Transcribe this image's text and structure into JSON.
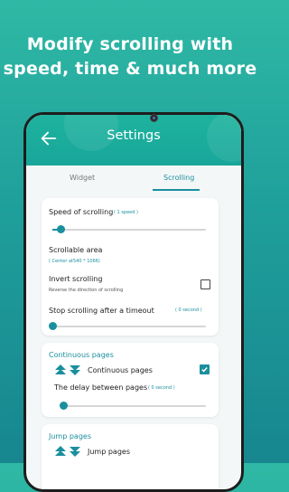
{
  "headline": {
    "line1": "Modify scrolling with",
    "line2": "speed, time & much more"
  },
  "appbar": {
    "title": "Settings",
    "back_icon": "arrow-left-icon"
  },
  "tabs": [
    {
      "label": "Widget",
      "selected": false
    },
    {
      "label": "Scrolling",
      "selected": true
    }
  ],
  "scroll_settings": {
    "speed": {
      "label": "Speed of scrolling",
      "value_text": "( 1 speed )",
      "fraction": 0.05
    },
    "area": {
      "label": "Scrollable area",
      "value_text": "( Center at540 * 1066)"
    },
    "invert": {
      "label": "Invert scrolling",
      "description": "Reverse the direction of scrolling",
      "checked": false
    },
    "timeout": {
      "label": "Stop scrolling after a timeout",
      "value_text": "( 0 second )",
      "fraction": 0.0
    }
  },
  "continuous_pages": {
    "title": "Continuous pages",
    "item_label": "Continuous pages",
    "checked": true,
    "delay_label": "The delay between pages",
    "delay_value": "( 0 second )",
    "delay_fraction": 0.0
  },
  "jump_pages": {
    "title": "Jump pages",
    "item_label": "Jump pages"
  },
  "colors": {
    "accent": "#1a8f9e",
    "background_top": "#2fb9a5",
    "background_bottom": "#17868f"
  }
}
